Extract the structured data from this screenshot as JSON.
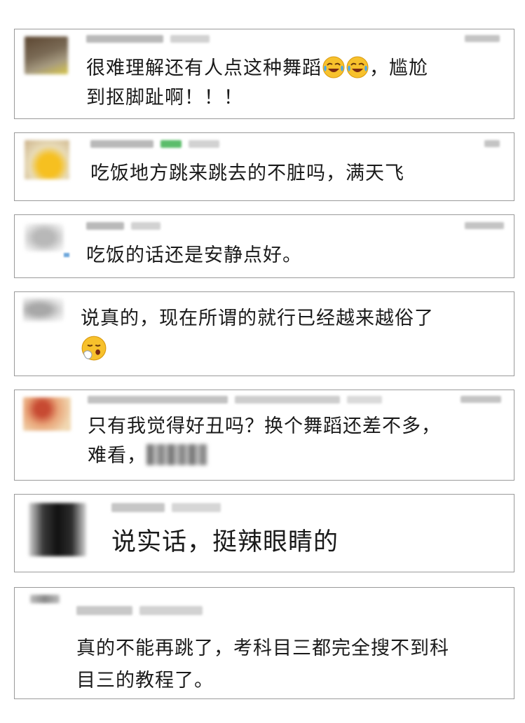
{
  "comments": [
    {
      "line1": "很难理解还有人点这种舞蹈",
      "line1_tail": "，尴尬",
      "line2": "到抠脚趾啊！！！",
      "emoji": [
        "laughing-crying-emoji",
        "laughing-crying-emoji"
      ]
    },
    {
      "line1": "吃饭地方跳来跳去的不脏吗，满天飞"
    },
    {
      "line1": "吃饭的话还是安静点好。"
    },
    {
      "line1": "说真的，现在所谓的就行已经越来越俗了",
      "emoji": [
        "sneezing-face-emoji"
      ]
    },
    {
      "line1": "只有我觉得好丑吗？换个舞蹈还差不多，",
      "line2": "难看，"
    },
    {
      "line1": "说实话，挺辣眼睛的"
    },
    {
      "line1": "真的不能再跳了，考科目三都完全搜不到科",
      "line2": "目三的教程了。"
    }
  ]
}
